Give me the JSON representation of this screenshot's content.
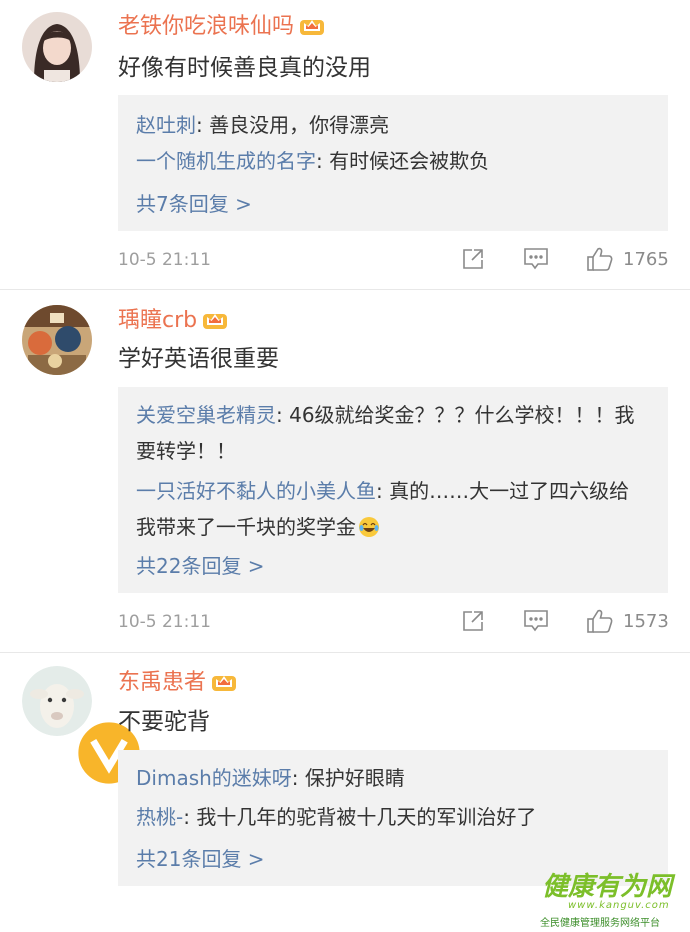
{
  "comments": [
    {
      "username": "老铁你吃浪味仙吗",
      "text": "好像有时候善良真的没用",
      "replies": [
        {
          "name": "赵吐刺",
          "sep": ": ",
          "text": "善良没用，你得漂亮"
        },
        {
          "name": "一个随机生成的名字",
          "sep": ": ",
          "text": "有时候还会被欺负"
        }
      ],
      "more": "共7条回复 >",
      "time": "10-5 21:11",
      "likes": "1765"
    },
    {
      "username": "瑀瞳crb",
      "text": "学好英语很重要",
      "replies": [
        {
          "name": "关爱空巢老精灵",
          "sep": ": ",
          "text": "46级就给奖金？？？什么学校！！！我要转学！！"
        },
        {
          "name": "一只活好不黏人的小美人鱼",
          "sep": ": ",
          "text": "真的……大一过了四六级给我带来了一千块的奖学金"
        }
      ],
      "more": "共22条回复 >",
      "time": "10-5 21:11",
      "likes": "1573"
    },
    {
      "username": "东禹患者",
      "text": "不要驼背",
      "replies": [
        {
          "name": "Dimash的迷妹呀",
          "sep": ": ",
          "text": "保护好眼睛"
        },
        {
          "name": "热桃-",
          "sep": ": ",
          "text": "我十几年的驼背被十几天的军训治好了"
        }
      ],
      "more": "共21条回复 >"
    }
  ],
  "watermark": {
    "main": "健康有为网",
    "url": "www.kanguv.com",
    "sub": "全民健康管理服务网络平台"
  },
  "colors": {
    "username": "#eb7350",
    "reply_name": "#5b7daa",
    "reply_bg": "#f2f2f2",
    "meta": "#9e9e9e"
  },
  "icons": [
    "crown-badge-icon",
    "share-icon",
    "comment-icon",
    "like-icon",
    "emoji-laugh-icon",
    "verified-badge-icon"
  ]
}
